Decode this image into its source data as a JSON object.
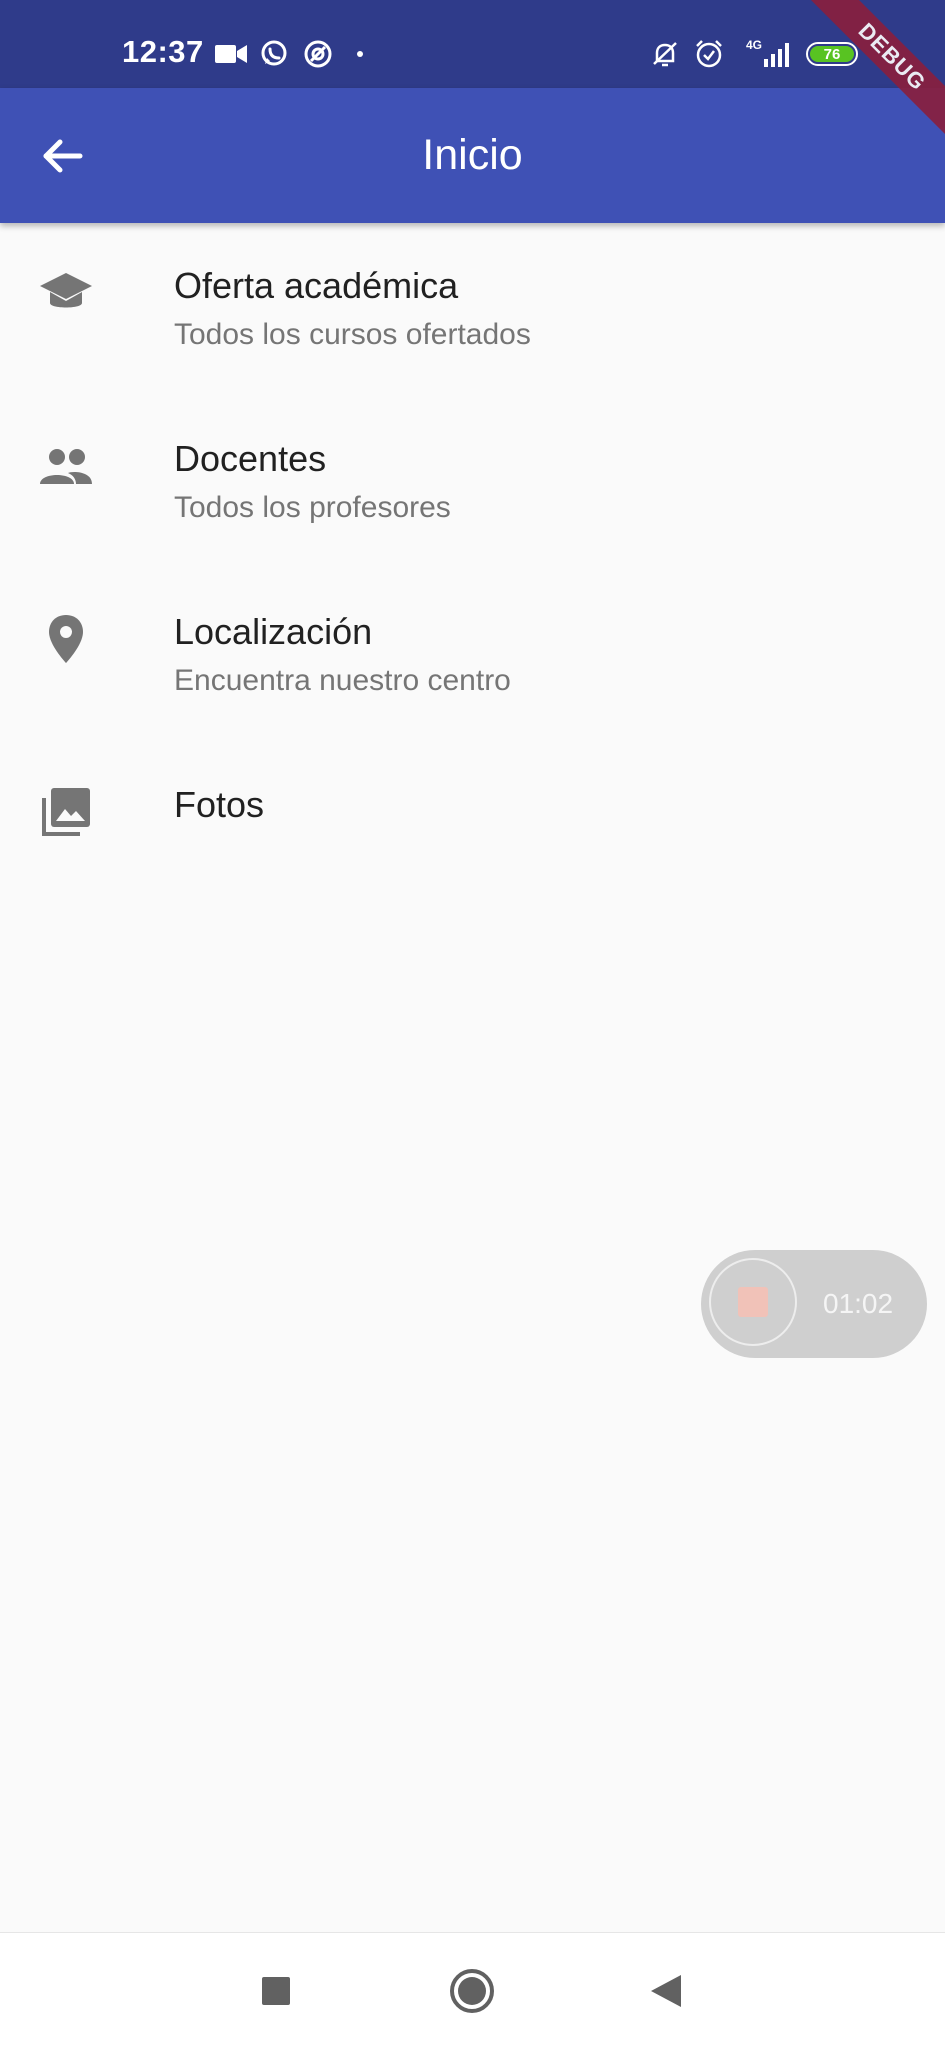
{
  "status_bar": {
    "time": "12:37",
    "network": "4G",
    "battery": "76",
    "icons": [
      "video-camera-icon",
      "whatsapp-icon",
      "at-sign-icon",
      "dot-icon",
      "bell-muted-icon",
      "alarm-clock-icon",
      "signal-icon",
      "battery-icon"
    ]
  },
  "debug_banner": "DEBUG",
  "app_bar": {
    "title": "Inicio",
    "back_icon": "arrow-left-icon",
    "color": "#3f51b5"
  },
  "menu": {
    "items": [
      {
        "icon": "graduation-cap-icon",
        "title": "Oferta académica",
        "subtitle": "Todos los cursos ofertados"
      },
      {
        "icon": "people-icon",
        "title": "Docentes",
        "subtitle": "Todos los profesores"
      },
      {
        "icon": "location-pin-icon",
        "title": "Localización",
        "subtitle": "Encuentra nuestro centro"
      },
      {
        "icon": "photo-library-icon",
        "title": "Fotos"
      }
    ]
  },
  "recorder": {
    "time": "01:02"
  },
  "nav_bar": {
    "icons": [
      "recents-square-icon",
      "home-circle-icon",
      "back-triangle-icon"
    ]
  }
}
